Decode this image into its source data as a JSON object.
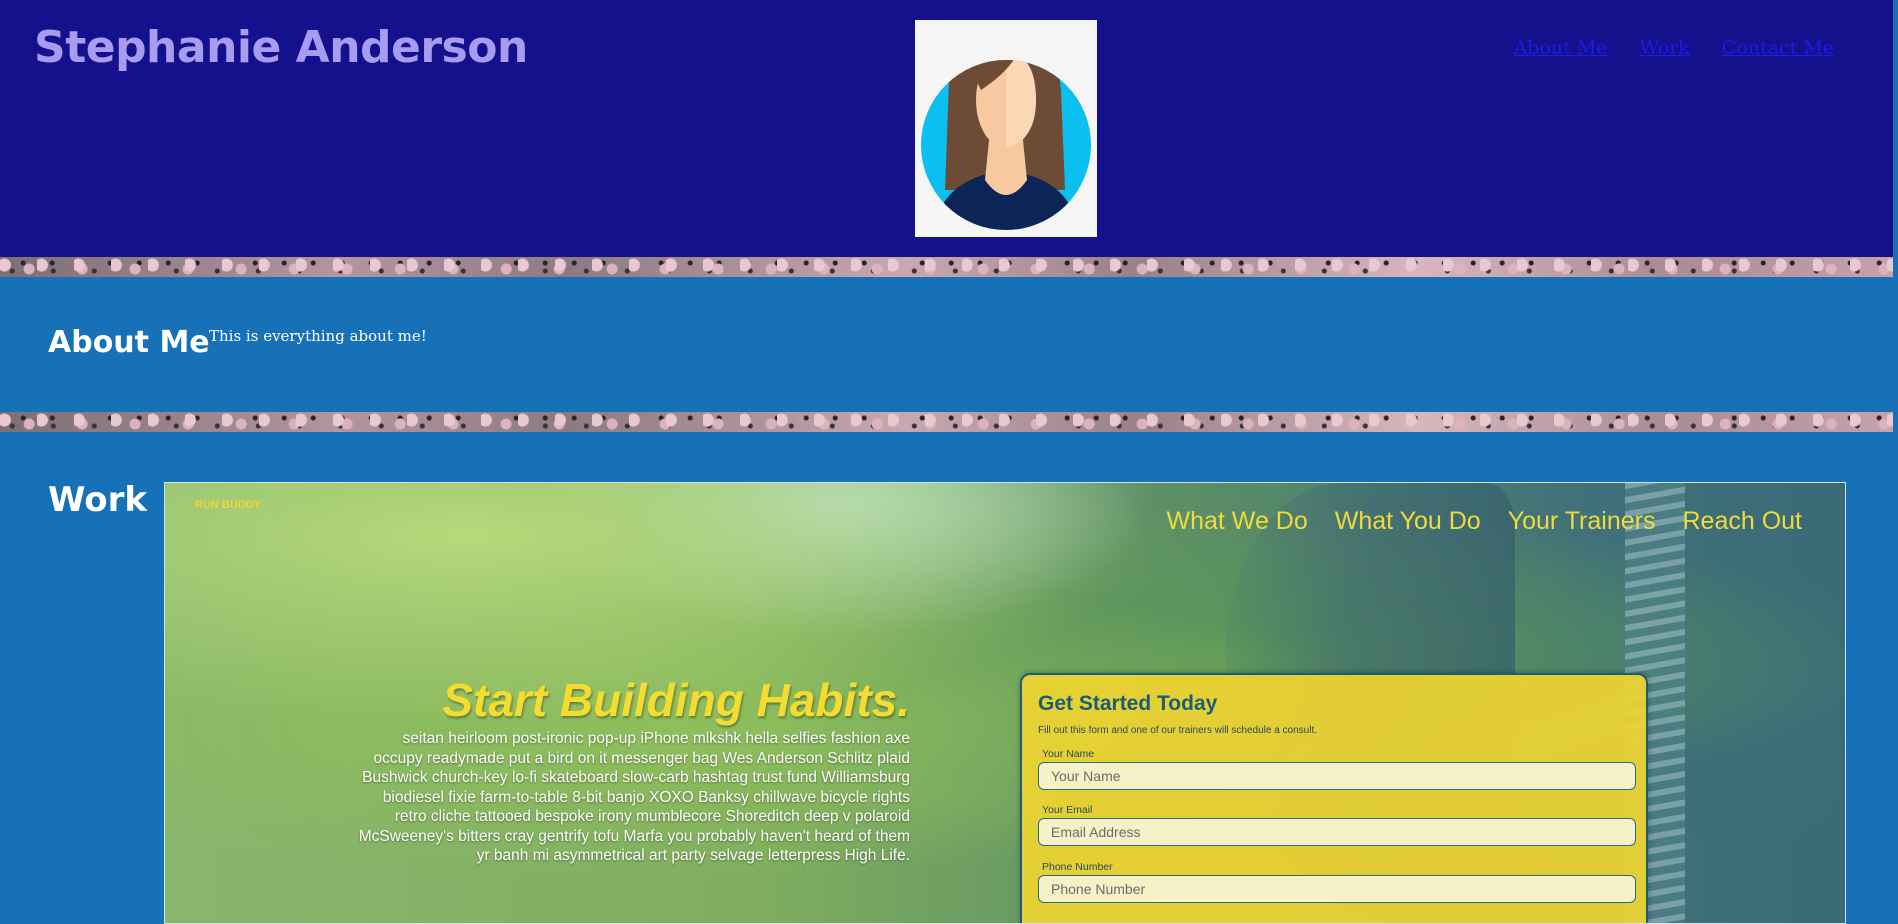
{
  "header": {
    "title": "Stephanie Anderson",
    "nav": [
      "About Me",
      "Work",
      "Contact Me"
    ]
  },
  "about": {
    "heading": "About Me",
    "text": "This is everything about me!"
  },
  "work": {
    "heading": "Work",
    "project": {
      "logo": "RUN BUDDY",
      "nav": [
        "What We Do",
        "What You Do",
        "Your Trainers",
        "Reach Out"
      ],
      "hero_title": "Start Building Habits.",
      "hero_text": "seitan heirloom post-ironic pop-up iPhone mlkshk hella selfies fashion axe occupy readymade put a bird on it messenger bag Wes Anderson Schlitz plaid Bushwick church-key lo-fi skateboard slow-carb hashtag trust fund Williamsburg biodiesel fixie farm-to-table 8-bit banjo XOXO Banksy chillwave bicycle rights retro cliche tattooed bespoke irony mumblecore Shoreditch deep v polaroid McSweeney's bitters cray gentrify tofu Marfa you probably haven't heard of them yr banh mi asymmetrical art party selvage letterpress High Life.",
      "form": {
        "title": "Get Started Today",
        "subtitle": "Fill out this form and one of our trainers will schedule a consult.",
        "fields": [
          {
            "label": "Your Name",
            "placeholder": "Your Name"
          },
          {
            "label": "Your Email",
            "placeholder": "Email Address"
          },
          {
            "label": "Phone Number",
            "placeholder": "Phone Number"
          }
        ]
      }
    }
  },
  "colors": {
    "header_bg": "#15108b",
    "section_bg": "#1671b6",
    "brand": "#a89cf0",
    "project_accent": "#f5dc31"
  }
}
